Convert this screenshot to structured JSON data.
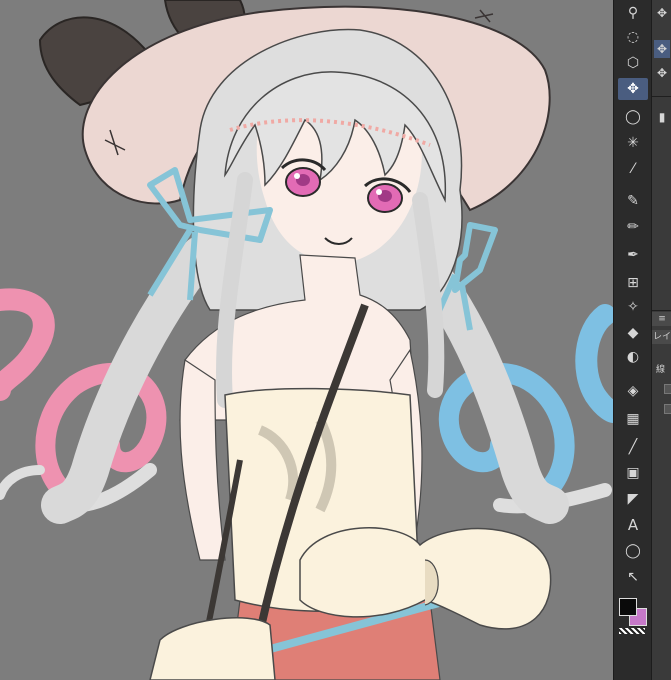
{
  "artwork": {
    "subject": "anime-girl-illustration",
    "colors": {
      "canvas_bg": "#7d7d7d",
      "hair": "#dedede",
      "hat": "#ecd7d2",
      "hat_ribbon": "#4a4340",
      "skin": "#f9ece6",
      "eyes": "#e26bb5",
      "hair_ribbon": "#86c4d7",
      "dress": "#fbf2dd",
      "skirt": "#df7f76",
      "strap": "#3c3835",
      "pink_curl": "#ee92b0",
      "blue_curl": "#7ec0e3"
    }
  },
  "toolbar": {
    "tools": [
      {
        "name": "zoom-tool-icon",
        "glyph": "⚲"
      },
      {
        "name": "lasso-select-icon",
        "glyph": "◌"
      },
      {
        "name": "object-select-icon",
        "glyph": "⬡"
      },
      {
        "name": "move-layer-icon",
        "glyph": "✥",
        "active": true
      },
      {
        "name": "lasso-fill-icon",
        "glyph": "◯"
      },
      {
        "name": "magic-wand-icon",
        "glyph": "✳"
      },
      {
        "name": "eyedropper-icon",
        "glyph": "⁄"
      },
      {
        "name": "pen-icon",
        "glyph": "✎"
      },
      {
        "name": "pencil-icon",
        "glyph": "✏"
      },
      {
        "name": "brush-icon",
        "glyph": "✒"
      },
      {
        "name": "airbrush-icon",
        "glyph": "⊞"
      },
      {
        "name": "decoration-icon",
        "glyph": "✧"
      },
      {
        "name": "eraser-icon",
        "glyph": "◆"
      },
      {
        "name": "blend-icon",
        "glyph": "◐"
      },
      {
        "name": "fill-icon",
        "glyph": "◈"
      },
      {
        "name": "gradient-icon",
        "glyph": "▦"
      },
      {
        "name": "figure-icon",
        "glyph": "╱"
      },
      {
        "name": "frame-border-icon",
        "glyph": "▣"
      },
      {
        "name": "ruler-icon",
        "glyph": "◤"
      },
      {
        "name": "text-tool-icon",
        "glyph": "A"
      },
      {
        "name": "balloon-icon",
        "glyph": "◯"
      },
      {
        "name": "correct-line-icon",
        "glyph": "↖"
      }
    ],
    "foreground_color": "#0a0a0a",
    "background_color": "#c679c9"
  },
  "subpanel": {
    "tab_label": "レイ",
    "small_label": "線"
  }
}
